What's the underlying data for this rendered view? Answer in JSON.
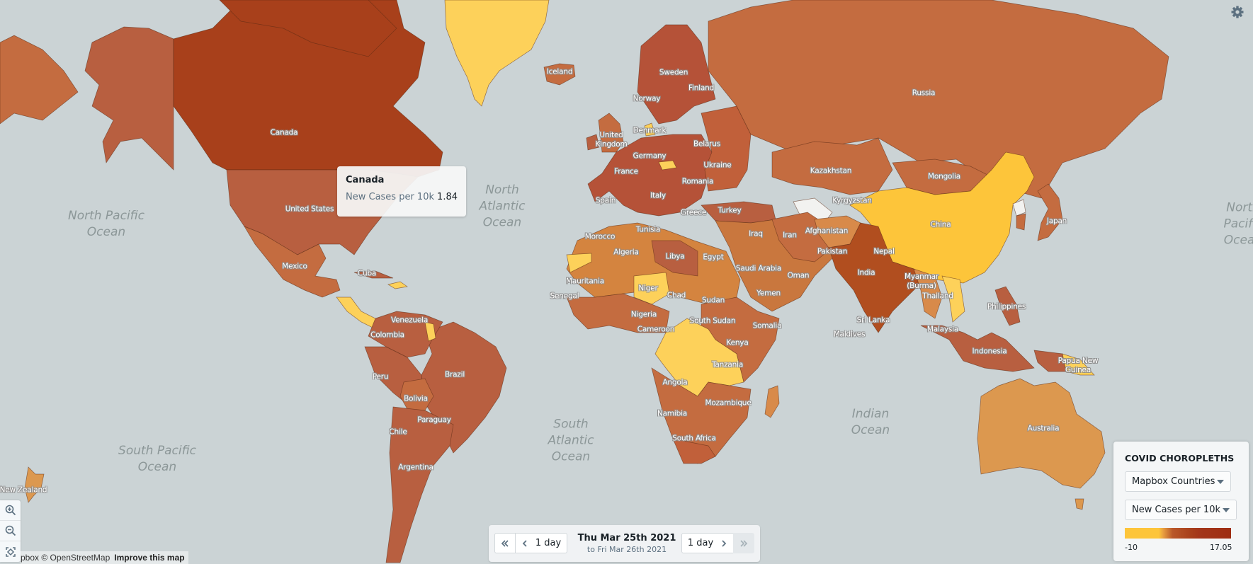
{
  "map": {
    "ocean_color": "#cbd3d5",
    "color_scale": {
      "low": "#fdc53a",
      "mid": "#c16a3f",
      "high": "#a3361a"
    },
    "country_labels": [
      "Canada",
      "United States",
      "Mexico",
      "Cuba",
      "Venezuela",
      "Colombia",
      "Peru",
      "Brazil",
      "Bolivia",
      "Paraguay",
      "Chile",
      "Argentina",
      "Iceland",
      "Sweden",
      "Finland",
      "Norway",
      "Denmark",
      "United Kingdom",
      "Belarus",
      "Germany",
      "Ukraine",
      "France",
      "Romania",
      "Italy",
      "Spain",
      "Greece",
      "Turkey",
      "Morocco",
      "Tunisia",
      "Algeria",
      "Libya",
      "Egypt",
      "Mauritania",
      "Niger",
      "Chad",
      "Sudan",
      "Senegal",
      "Nigeria",
      "Cameroon",
      "South Sudan",
      "Somalia",
      "Kenya",
      "Tanzania",
      "Angola",
      "Mozambique",
      "Namibia",
      "South Africa",
      "Russia",
      "Kazakhstan",
      "Mongolia",
      "Kyrgyzstan",
      "China",
      "Afghanistan",
      "Iran",
      "Iraq",
      "Pakistan",
      "Nepal",
      "Saudi Arabia",
      "Oman",
      "India",
      "Myanmar (Burma)",
      "Yemen",
      "Thailand",
      "Sri Lanka",
      "Maldives",
      "Malaysia",
      "Philippines",
      "Indonesia",
      "Papua New Guinea",
      "Australia",
      "Japan",
      "New Zealand"
    ],
    "ocean_labels": {
      "north_pacific_left": "North Pacific Ocean",
      "north_pacific_right": "North Pacific Ocean",
      "north_atlantic": "North Atlantic Ocean",
      "south_pacific": "South Pacific Ocean",
      "south_atlantic": "South Atlantic Ocean",
      "indian": "Indian Ocean"
    }
  },
  "tooltip": {
    "country": "Canada",
    "metric_label": "New Cases per 10k",
    "metric_value": "1.84"
  },
  "settings": {
    "icon": "gear-icon"
  },
  "zoom_controls": {
    "zoom_in": "zoom-in-icon",
    "zoom_out": "zoom-out-icon",
    "fit": "fit-bounds-icon"
  },
  "attribution": {
    "text": "pbox © OpenStreetMap",
    "improve": "Improve this map"
  },
  "time_controls": {
    "jump_back_icon": "double-chevron-left-icon",
    "step_back_label": "1 day",
    "date_main": "Thu Mar 25th 2021",
    "date_sub": "to Fri Mar 26th 2021",
    "step_forward_label": "1 day",
    "jump_forward_icon": "double-chevron-right-icon",
    "jump_forward_disabled": true
  },
  "legend_panel": {
    "title": "COVID CHOROPLETHS",
    "boundary_select": "Mapbox Countries",
    "metric_select": "New Cases per 10k",
    "scale_min": "-10",
    "scale_max": "17.05"
  }
}
